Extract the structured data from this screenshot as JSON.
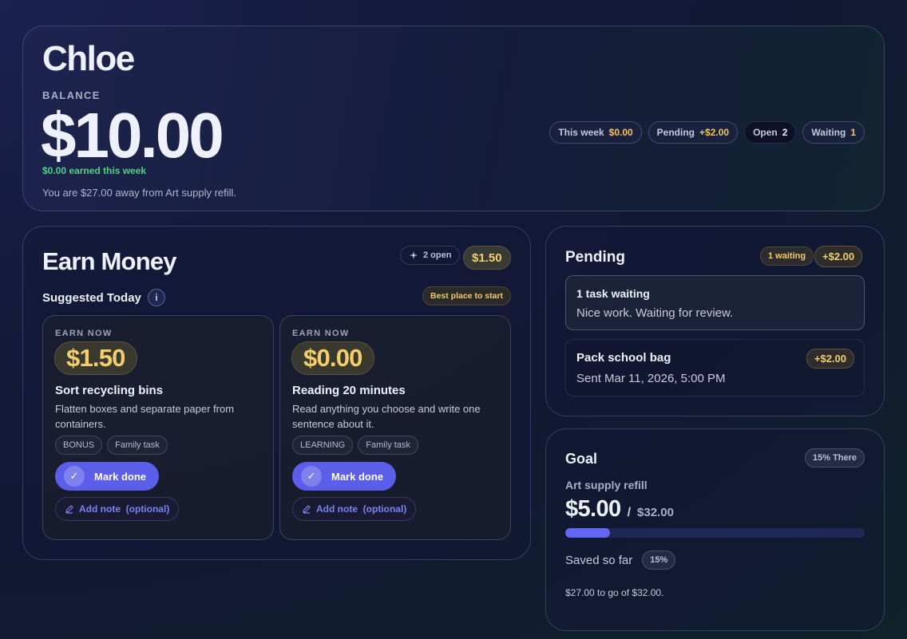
{
  "hero": {
    "name": "Chloe",
    "balance_label": "BALANCE",
    "balance": "$10.00",
    "earned_week": "$0.00 earned this week",
    "away_text": "You are $27.00 away from Art supply refill.",
    "stats": [
      {
        "label": "This week",
        "value": "$0.00"
      },
      {
        "label": "Pending",
        "value": "+$2.00"
      },
      {
        "label": "Open",
        "value": "2"
      },
      {
        "label": "Waiting",
        "value": "1"
      }
    ]
  },
  "earn": {
    "title": "Earn Money",
    "open_chip": "2 open",
    "amount_chip": "$1.50",
    "suggested": "Suggested Today",
    "info_glyph": "i",
    "best_chip": "Best place to start",
    "tasks": [
      {
        "earn_label": "EARN NOW",
        "price": "$1.50",
        "title": "Sort recycling bins",
        "desc": "Flatten boxes and separate paper from containers.",
        "tags": [
          "BONUS",
          "Family task"
        ],
        "mark_label": "Mark done",
        "note_label": "Add note  (optional)"
      },
      {
        "earn_label": "EARN NOW",
        "price": "$0.00",
        "title": "Reading 20 minutes",
        "desc": "Read anything you choose and write one sentence about it.",
        "tags": [
          "LEARNING",
          "Family task"
        ],
        "mark_label": "Mark done",
        "note_label": "Add note  (optional)"
      }
    ]
  },
  "pending": {
    "title": "Pending",
    "waiting_chip": "1 waiting",
    "total_chip": "+$2.00",
    "summary_title": "1 task waiting",
    "summary_sub": "Nice work. Waiting for review.",
    "item_title": "Pack school bag",
    "item_sub": "Sent Mar 11, 2026, 5:00 PM",
    "item_amount": "+$2.00"
  },
  "goal": {
    "title": "Goal",
    "there_chip": "15% There",
    "name": "Art supply refill",
    "saved": "$5.00",
    "slash": "/",
    "target": "$32.00",
    "progress_pct": 15,
    "saved_label": "Saved so far",
    "pct_chip": "15%",
    "togo": "$27.00 to go of $32.00."
  },
  "colors": {
    "accent": "#5b5ee8",
    "gold": "#f3cf6c",
    "green": "#4fd08a"
  }
}
